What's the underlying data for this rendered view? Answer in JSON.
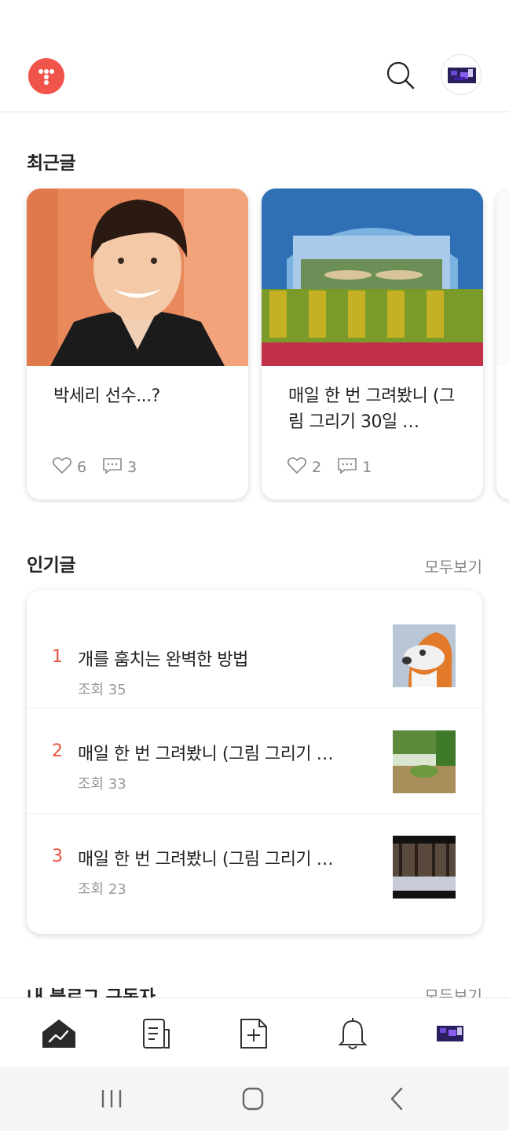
{
  "recent": {
    "title": "최근글",
    "cards": [
      {
        "title": "박세리 선수...?",
        "likes": "6",
        "comments": "3"
      },
      {
        "title": "매일 한 번 그려봤니 (그림 그리기 30일 …",
        "likes": "2",
        "comments": "1"
      }
    ]
  },
  "popular": {
    "title": "인기글",
    "see_all": "모두보기",
    "items": [
      {
        "rank": "1",
        "title": "개를 훔치는 완벽한 방법",
        "views": "조회 35"
      },
      {
        "rank": "2",
        "title": "매일 한 번 그려봤니 (그림 그리기 …",
        "views": "조회 33"
      },
      {
        "rank": "3",
        "title": "매일 한 번 그려봤니 (그림 그리기 …",
        "views": "조회 23"
      }
    ]
  },
  "subscribers": {
    "title": "내 블로그 구독자",
    "see_all": "모두보기"
  },
  "colors": {
    "accent": "#f0544a",
    "rank": "#e8543f"
  },
  "icons": {
    "header": [
      "tistory-logo-icon",
      "search-icon",
      "avatar"
    ],
    "bottom_nav": [
      "stats-icon",
      "posts-icon",
      "new-post-icon",
      "bell-icon",
      "avatar"
    ],
    "system_nav": [
      "recents-icon",
      "home-icon",
      "back-icon"
    ]
  }
}
